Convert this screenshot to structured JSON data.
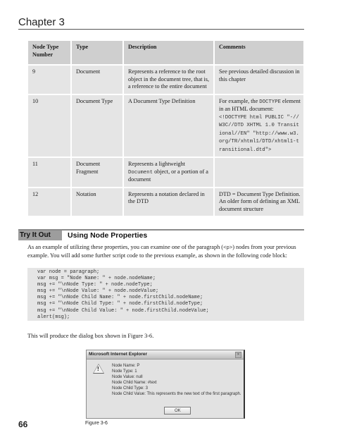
{
  "header": {
    "chapter": "Chapter 3"
  },
  "table": {
    "headers": [
      "Node Type Number",
      "Type",
      "Description",
      "Comments"
    ],
    "rows": [
      {
        "number": "9",
        "type": "Document",
        "description": "Represents a reference to the root object in the document tree, that is, a reference to the entire document",
        "comments": "See previous detailed discussion in this chapter"
      },
      {
        "number": "10",
        "type": "Document Type",
        "description": "A Document Type Definition",
        "comments_prefix": "For example, the ",
        "comments_code": "DOCTYPE",
        "comments_suffix": " element in an HTML document:",
        "comments_code_block": "<!DOCTYPE html PUBLIC \"-//W3C//DTD XHTML 1.0 Transitional//EN\" \"http://www.w3.org/TR/xhtml1/DTD/xhtml1-transitional.dtd\">"
      },
      {
        "number": "11",
        "type": "Document Fragment",
        "description_prefix": "Represents a lightweight ",
        "description_code": "Document",
        "description_suffix": " object, or a portion of a document",
        "comments": ""
      },
      {
        "number": "12",
        "type": "Notation",
        "description": "Represents a notation declared in the DTD",
        "comments": "DTD = Document Type Definition. An older form of defining an XML document structure"
      }
    ]
  },
  "try_it_out": {
    "label": "Try It Out",
    "title": "Using Node Properties"
  },
  "paragraph1": {
    "before": "As an example of utilizing these properties, you can examine one of the paragraph (",
    "code": "<p>",
    "after": ") nodes from your previous example. You will add some further script code to the previous example, as shown in the following code block:"
  },
  "code_lines": [
    "var node = paragraph;",
    "var msg = \"Node Name: \" + node.nodeName;",
    "msg += \"\\nNode Type: \" + node.nodeType;",
    "msg += \"\\nNode Value: \" + node.nodeValue;",
    "msg += \"\\nNode Child Name: \" + node.firstChild.nodeName;",
    "msg += \"\\nNode Child Type: \" + node.firstChild.nodeType;",
    "msg += \"\\nNode Child Value: \" + node.firstChild.nodeValue;",
    "alert(msg);"
  ],
  "paragraph2": "This will produce the dialog box shown in Figure 3-6.",
  "dialog": {
    "title": "Microsoft Internet Explorer",
    "close_glyph": "×",
    "warning_glyph": "!",
    "lines": [
      "Node Name: P",
      "Node Type: 1",
      "Node Value: null",
      "Node Child Name: #text",
      "Node Child Type: 3",
      "Node Child Value: This represents the new text of the first paragraph."
    ],
    "ok_label": "OK"
  },
  "figure_caption": "Figure 3-6",
  "page_number": "66"
}
